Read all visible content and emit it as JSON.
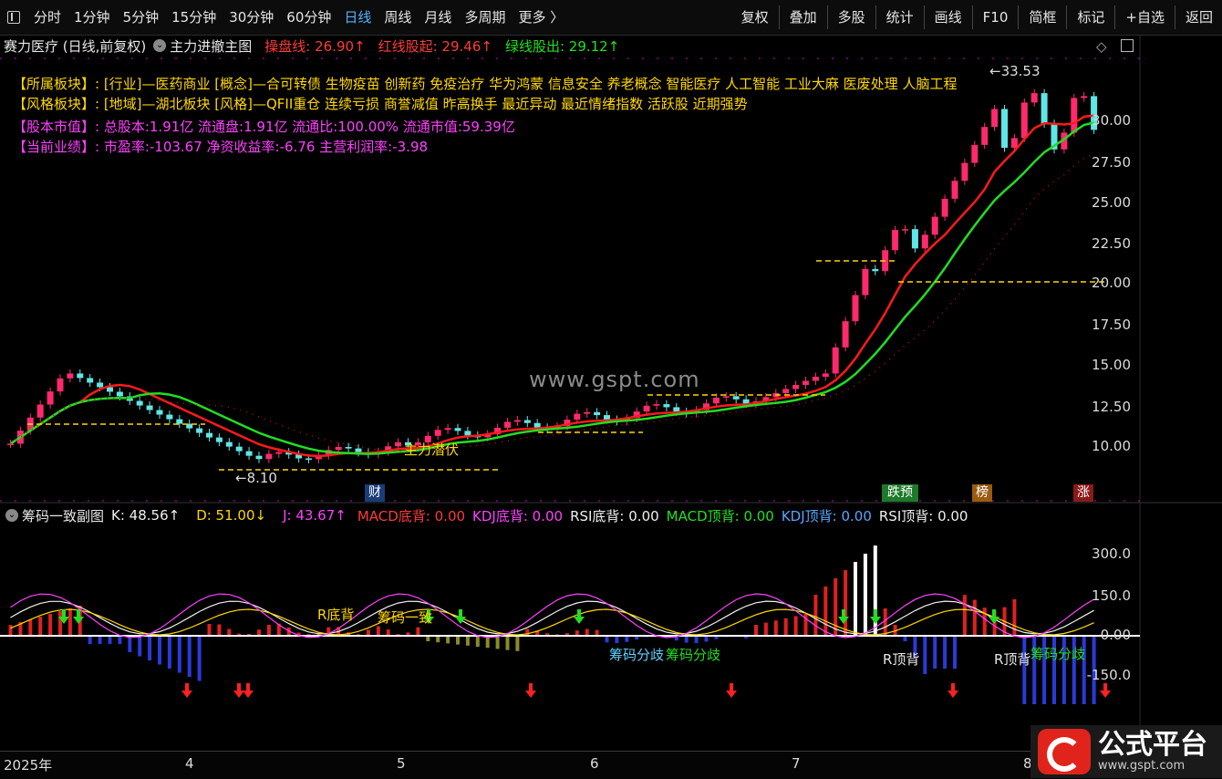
{
  "toolbar": {
    "periods": [
      "分时",
      "1分钟",
      "5分钟",
      "15分钟",
      "30分钟",
      "60分钟",
      "日线",
      "周线",
      "月线",
      "多周期",
      "更多 〉"
    ],
    "active_period": "日线",
    "actions": [
      "复权",
      "叠加",
      "多股",
      "统计",
      "画线",
      "F10",
      "简框",
      "标记",
      "+自选",
      "返回"
    ]
  },
  "main_title": {
    "stock": "赛力医疗 (日线,前复权)",
    "indicator": "主力进撤主图",
    "items": [
      {
        "label": "操盘线: 26.90↑",
        "color": "red"
      },
      {
        "label": "红线股起: 29.46↑",
        "color": "red"
      },
      {
        "label": "绿线股出: 29.12↑",
        "color": "green"
      }
    ]
  },
  "info": {
    "line1": "【所属板块】:  [行业]—医药商业 [概念]—合可转债 生物疫苗 创新药 免疫治疗 华为鸿蒙 信息安全 养老概念 智能医疗 人工智能 工业大麻 医废处理 人脑工程",
    "line2": "【风格板块】:  [地域]—湖北板块 [风格]—QFII重仓 连续亏损 商誉减值 昨高换手 最近异动 最近情绪指数 活跃股 近期强势",
    "line3": "【股本市值】:  总股本:1.91亿 流通盘:1.91亿 流通比:100.00% 流通市值:59.39亿",
    "line4": "【当前业绩】:  市盈率:-103.67 净资收益率:-6.76 主营利润率:-3.98"
  },
  "main_axis": {
    "labels": [
      "30.00",
      "27.50",
      "25.00",
      "22.50",
      "20.00",
      "17.50",
      "15.00",
      "12.50",
      "10.00"
    ]
  },
  "annotations": {
    "high": "←33.53",
    "low": "←8.10",
    "lurk": "主力潜伏",
    "cai": "财",
    "badges": [
      "跌预",
      "榜",
      "涨"
    ],
    "sub_texts": [
      "R底背",
      "筹码一致",
      "筹码分歧",
      "筹码分歧",
      "R顶背",
      "R顶背",
      "筹码分歧"
    ]
  },
  "watermark": "www.gspt.com",
  "sub_title": {
    "indicator": "筹码一致副图",
    "items": [
      {
        "label": "K: 48.56↑",
        "color": "white"
      },
      {
        "label": "D: 51.00↓",
        "color": "yellow"
      },
      {
        "label": "J: 43.67↑",
        "color": "magenta"
      },
      {
        "label": "MACD底背: 0.00",
        "color": "red"
      },
      {
        "label": "KDJ底背: 0.00",
        "color": "magenta"
      },
      {
        "label": "RSI底背: 0.00",
        "color": "white"
      },
      {
        "label": "MACD顶背: 0.00",
        "color": "green"
      },
      {
        "label": "KDJ顶背: 0.00",
        "color": "blue"
      },
      {
        "label": "RSI顶背: 0.00",
        "color": "white"
      }
    ]
  },
  "sub_axis": {
    "labels": [
      "300.0",
      "150.0",
      "0.00",
      "-150.0"
    ]
  },
  "x_axis": {
    "labels": [
      "2025年",
      "4",
      "5",
      "6",
      "7",
      "8"
    ]
  },
  "logo": {
    "name": "公式平台",
    "url": "www.gspt.com"
  },
  "colors": {
    "up": "#ff2a6d",
    "down": "#5fe6e6",
    "red_line": "#ff1a1a",
    "green_line": "#22dd22",
    "yellow": "#ffd700"
  }
}
